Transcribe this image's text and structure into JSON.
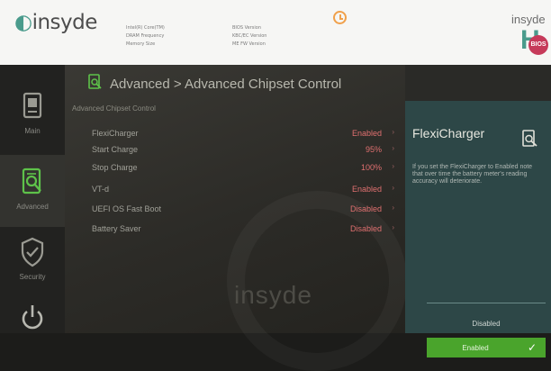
{
  "header": {
    "logo_text": "insyde",
    "info_left": [
      "Intel(R) Core(TM)",
      "DRAM Frequency",
      "Memory Size"
    ],
    "info_right": [
      "BIOS Version",
      "KBC/EC Version",
      "ME FW Version"
    ],
    "brand_top": "insyde",
    "brand_letter": "H",
    "brand_badge": "BIOS"
  },
  "sidebar": {
    "items": [
      {
        "label": "Main",
        "icon": "main-icon"
      },
      {
        "label": "Advanced",
        "icon": "advanced-icon"
      },
      {
        "label": "Security",
        "icon": "security-icon"
      },
      {
        "label": "",
        "icon": "power-icon"
      }
    ]
  },
  "main": {
    "title": "Advanced > Advanced Chipset Control",
    "subtitle": "Advanced Chipset Control",
    "rows": [
      {
        "label": "FlexiCharger",
        "value": "Enabled"
      },
      {
        "label": "Start Charge",
        "value": "95%"
      },
      {
        "label": "Stop Charge",
        "value": "100%"
      },
      {
        "label": "VT-d",
        "value": "Enabled"
      },
      {
        "label": "UEFI OS Fast Boot",
        "value": "Disabled"
      },
      {
        "label": "Battery Saver",
        "value": "Disabled"
      }
    ],
    "watermark": "insyde"
  },
  "help": {
    "title": "FlexiCharger",
    "description": "If you set the FlexiCharger to Enabled note that over time the battery meter's reading accuracy will deteriorate.",
    "option_disabled": "Disabled",
    "option_enabled": "Enabled"
  },
  "colors": {
    "accent_green": "#4aa42c",
    "value_red": "#e07070",
    "brand_teal": "#4a9b8c"
  }
}
